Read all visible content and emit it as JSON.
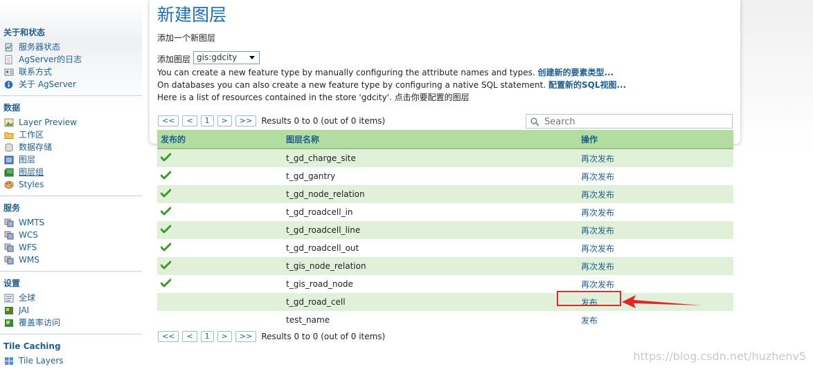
{
  "sidebar": {
    "sections": [
      {
        "title": "关于和状态",
        "items": [
          {
            "label": "服务器状态",
            "icon": "server-status-icon"
          },
          {
            "label": "AgServer的日志",
            "icon": "log-file-icon"
          },
          {
            "label": "联系方式",
            "icon": "contact-icon"
          },
          {
            "label": "关于 AgServer",
            "icon": "about-icon"
          }
        ]
      },
      {
        "title": "数据",
        "items": [
          {
            "label": "Layer Preview",
            "icon": "layer-preview-icon"
          },
          {
            "label": "工作区",
            "icon": "folder-icon"
          },
          {
            "label": "数据存储",
            "icon": "datastore-icon"
          },
          {
            "label": "图层",
            "icon": "layer-icon"
          },
          {
            "label": "图层组",
            "icon": "layer-group-icon"
          },
          {
            "label": "Styles",
            "icon": "styles-icon"
          }
        ]
      },
      {
        "title": "服务",
        "items": [
          {
            "label": "WMTS",
            "icon": "service-icon"
          },
          {
            "label": "WCS",
            "icon": "service-icon"
          },
          {
            "label": "WFS",
            "icon": "service-icon"
          },
          {
            "label": "WMS",
            "icon": "service-icon"
          }
        ]
      },
      {
        "title": "设置",
        "items": [
          {
            "label": "全球",
            "icon": "global-settings-icon"
          },
          {
            "label": "JAI",
            "icon": "jai-icon"
          },
          {
            "label": "覆盖率访问",
            "icon": "coverage-access-icon"
          }
        ]
      },
      {
        "title": "Tile Caching",
        "items": [
          {
            "label": "Tile Layers",
            "icon": "tile-layers-icon"
          }
        ]
      }
    ]
  },
  "main": {
    "title": "新建图层",
    "subtitle": "添加一个新图层",
    "add_layer_label": "添加图层",
    "store_value": "gis:gdcity",
    "line1_text": "You can create a new feature type by manually configuring the attribute names and types.",
    "line1_link": "创建新的要素类型...",
    "line2_text": "On databases you can also create a new feature type by configuring a native SQL statement.",
    "line2_link": "配置新的SQL视图...",
    "line3_text": "Here is a list of resources contained in the store 'gdcity'. 点击你要配置的图层"
  },
  "pager": {
    "buttons": [
      "<<",
      "<",
      "1",
      ">",
      ">>"
    ],
    "results": "Results 0 to 0 (out of 0 items)"
  },
  "search": {
    "placeholder": "Search"
  },
  "table": {
    "headers": [
      "发布的",
      "图层名称",
      "操作"
    ],
    "rows": [
      {
        "published": true,
        "name": "t_gd_charge_site",
        "action": "再次发布"
      },
      {
        "published": true,
        "name": "t_gd_gantry",
        "action": "再次发布"
      },
      {
        "published": true,
        "name": "t_gd_node_relation",
        "action": "再次发布"
      },
      {
        "published": true,
        "name": "t_gd_roadcell_in",
        "action": "再次发布"
      },
      {
        "published": true,
        "name": "t_gd_roadcell_line",
        "action": "再次发布"
      },
      {
        "published": true,
        "name": "t_gd_roadcell_out",
        "action": "再次发布"
      },
      {
        "published": true,
        "name": "t_gis_node_relation",
        "action": "再次发布"
      },
      {
        "published": true,
        "name": "t_gis_road_node",
        "action": "再次发布"
      },
      {
        "published": false,
        "name": "t_gd_road_cell",
        "action": "发布"
      },
      {
        "published": false,
        "name": "test_name",
        "action": "发布"
      }
    ]
  },
  "watermark": "https://blog.csdn.net/huzhenv5",
  "colors": {
    "link": "#1f5f8f",
    "title": "#1f6fb0",
    "row_alt": "#e1f0d8",
    "header": "#b3dca0",
    "highlight": "#e0282a"
  }
}
